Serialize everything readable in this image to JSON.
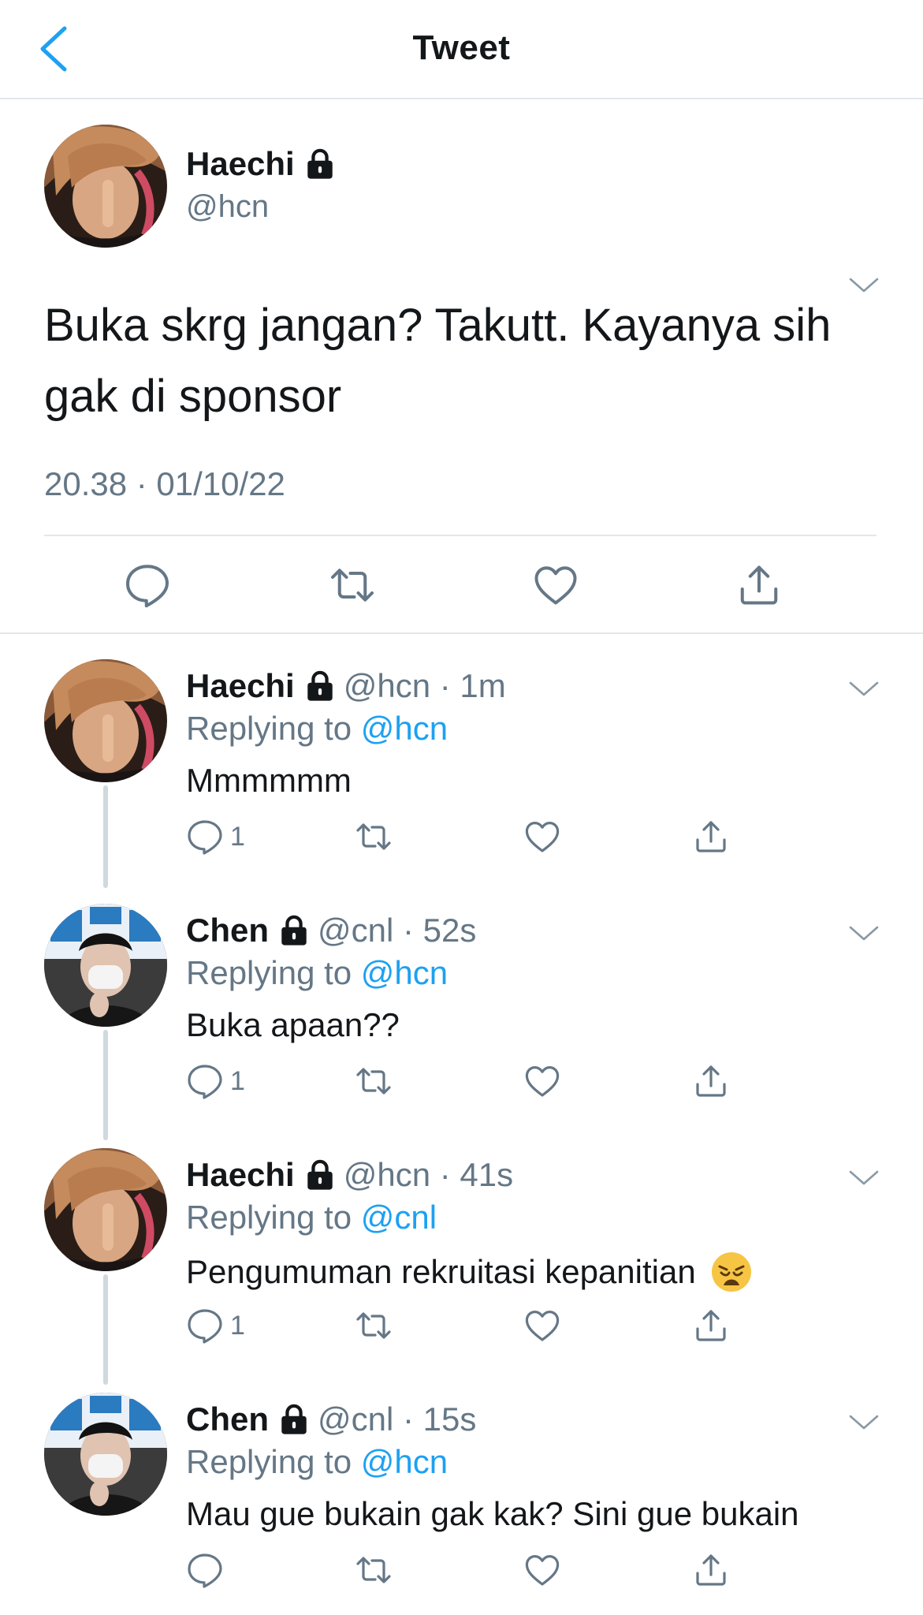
{
  "header": {
    "title": "Tweet"
  },
  "main_tweet": {
    "name": "Haechi",
    "handle": "@hcn",
    "text": "Buka skrg jangan? Takutt. Kayanya sih gak di sponsor",
    "timestamp": "20.38 · 01/10/22"
  },
  "replies": [
    {
      "name": "Haechi",
      "handle": "@hcn · 1m",
      "replying_prefix": "Replying to ",
      "replying_to": "@hcn",
      "text": "Mmmmmm",
      "reply_count": "1",
      "emoji": ""
    },
    {
      "name": "Chen",
      "handle": "@cnl · 52s",
      "replying_prefix": "Replying to ",
      "replying_to": "@hcn",
      "text": "Buka apaan??",
      "reply_count": "1",
      "emoji": ""
    },
    {
      "name": "Haechi",
      "handle": "@hcn · 41s",
      "replying_prefix": "Replying to ",
      "replying_to": "@cnl",
      "text": "Pengumuman rekruitasi kepanitian",
      "reply_count": "1",
      "emoji": "weary-face"
    },
    {
      "name": "Chen",
      "handle": "@cnl · 15s",
      "replying_prefix": "Replying to ",
      "replying_to": "@hcn",
      "text": "Mau gue bukain gak kak? Sini gue bukain",
      "reply_count": "",
      "emoji": ""
    }
  ],
  "colors": {
    "accent": "#1da1f2",
    "secondary_text": "#657786",
    "divider": "#e1e8ed",
    "icon": "#657786"
  }
}
